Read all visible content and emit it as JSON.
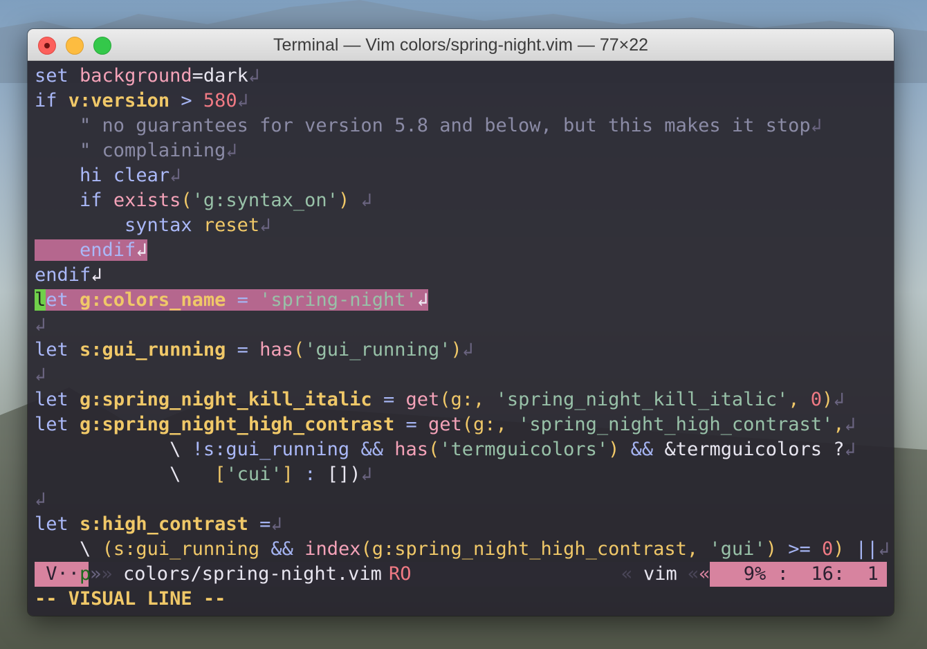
{
  "window": {
    "title": "Terminal — Vim colors/spring-night.vim — 77×22"
  },
  "colors": {
    "keyword": "#aab8f8",
    "variable": "#f0c868",
    "function": "#f4a2b8",
    "string": "#98c1a8",
    "number": "#f07a84",
    "comment": "#8b8ba6",
    "selection": "#b5678e",
    "cursor": "#70d04a",
    "statusline_accent": "#d7839f"
  },
  "code": {
    "l1": {
      "a": "set",
      "b": "background",
      "c": "=dark"
    },
    "l2": {
      "a": "if",
      "b": "v:version",
      "c": ">",
      "d": "580"
    },
    "l3": {
      "a": "\" no guarantees for version 5.8 and below, but this makes it stop"
    },
    "l4": {
      "a": "\" complaining"
    },
    "l5": {
      "a": "hi",
      "b": "clear"
    },
    "l6": {
      "a": "if",
      "b": "exists",
      "c": "(",
      "d": "'g:syntax_on'",
      "e": ")"
    },
    "l7": {
      "a": "syntax",
      "b": "reset"
    },
    "l8": {
      "a": "endif"
    },
    "l9": {
      "a": "endif"
    },
    "l10": {
      "cursor": "l",
      "a": "et",
      "b": "g:colors_name",
      "c": "=",
      "d": "'spring-night'"
    },
    "l12": {
      "a": "let",
      "b": "s:gui_running",
      "c": "=",
      "d": "has",
      "e": "(",
      "f": "'gui_running'",
      "g": ")"
    },
    "l14": {
      "a": "let",
      "b": "g:spring_night_kill_italic",
      "c": "=",
      "d": "get",
      "e": "(g:,",
      "f": "'spring_night_kill_italic'",
      "g": ",",
      "h": "0",
      "i": ")"
    },
    "l15": {
      "a": "let",
      "b": "g:spring_night_high_contrast",
      "c": "=",
      "d": "get",
      "e": "(g:,",
      "f": "'spring_night_high_contrast'",
      "g": ","
    },
    "l16": {
      "a": "\\",
      "b": "!s:gui_running",
      "c": "&&",
      "d": "has",
      "e": "(",
      "f": "'termguicolors'",
      "g": ")",
      "h": "&&",
      "i": "&termguicolors",
      "j": "?"
    },
    "l17": {
      "a": "\\",
      "b": "[",
      "c": "'cui'",
      "d": "]",
      "e": ":",
      "f": "[])"
    },
    "l19": {
      "a": "let",
      "b": "s:high_contrast",
      "c": "="
    },
    "l20": {
      "a": "\\",
      "b": "(s:gui_running",
      "c": "&&",
      "d": "index",
      "e": "(g:spring_night_high_contrast,",
      "f": "'gui'",
      "g": ")",
      "h": ">=",
      "i": "0",
      "j": ")",
      "k": "||"
    },
    "eol": "↲"
  },
  "statusline": {
    "mode": "V",
    "mode_dots": "··",
    "mode_p": "p",
    "sep_right": "»",
    "sep_right2": "»",
    "filename": "colors/spring-night.vim",
    "readonly": "RO",
    "sep_left": "«",
    "filetype": "vim",
    "sep_left2": "«",
    "sep_left3": "«",
    "percent": "9%",
    "colon": ":",
    "line": "16:",
    "col": "1"
  },
  "cmdline": {
    "text": "-- VISUAL LINE --"
  }
}
